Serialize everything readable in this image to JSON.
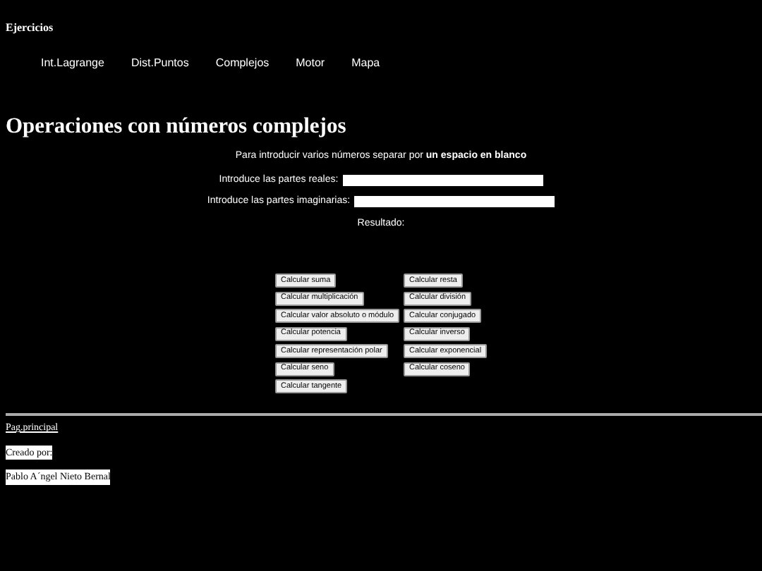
{
  "header": {
    "title": "Ejercicios"
  },
  "nav": [
    {
      "label": "Int.Lagrange"
    },
    {
      "label": "Dist.Puntos"
    },
    {
      "label": "Complejos"
    },
    {
      "label": "Motor"
    },
    {
      "label": "Mapa"
    }
  ],
  "heading": "Operaciones con números complejos",
  "instructions": "Para introducir varios números separar por **un espacio en blanco**",
  "fields": [
    {
      "label": "Introduce las partes reales:"
    },
    {
      "label": "Introduce las partes imaginarias:"
    }
  ],
  "result_label": "Resultado:",
  "buttons_left": [
    "Calcular suma",
    "Calcular multiplicación",
    "Calcular valor absoluto o módulo",
    "Calcular potencia",
    "Calcular representación polar",
    "Calcular seno",
    "Calcular tangente"
  ],
  "buttons_right": [
    "Calcular resta",
    "Calcular división",
    "Calcular conjugado",
    "Calcular inverso",
    "Calcular exponencial",
    "Calcular coseno"
  ],
  "footer": {
    "link": "Pag.principal",
    "credit_label": "Creado por:",
    "author": "Pablo A´ngel Nieto Bernal"
  }
}
